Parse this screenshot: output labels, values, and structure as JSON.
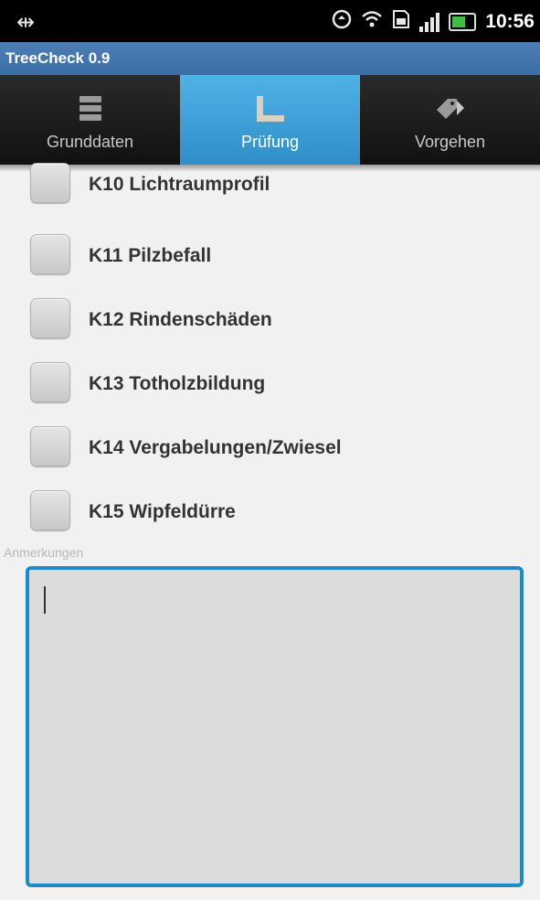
{
  "status_bar": {
    "usb_icon": "usb-icon",
    "time": "10:56",
    "icons": [
      "sync-icon",
      "wifi-icon",
      "sim-icon",
      "signal-icon",
      "battery-icon"
    ]
  },
  "app": {
    "title": "TreeCheck 0.9"
  },
  "tabs": [
    {
      "label": "Grunddaten",
      "icon": "list-icon",
      "active": false
    },
    {
      "label": "Prüfung",
      "icon": "ruler-icon",
      "active": true
    },
    {
      "label": "Vorgehen",
      "icon": "tag-arrow-icon",
      "active": false
    }
  ],
  "checklist": [
    {
      "label": "K10 Lichtraumprofil",
      "checked": false
    },
    {
      "label": "K11 Pilzbefall",
      "checked": false
    },
    {
      "label": "K12 Rindenschäden",
      "checked": false
    },
    {
      "label": "K13 Totholzbildung",
      "checked": false
    },
    {
      "label": "K14 Vergabelungen/Zwiesel",
      "checked": false
    },
    {
      "label": "K15 Wipfeldürre",
      "checked": false
    }
  ],
  "notes": {
    "label": "Anmerkungen",
    "value": ""
  },
  "colors": {
    "accent": "#1d8bc7",
    "title_bar": "#4578b0",
    "tab_active": "#3fa3da"
  }
}
